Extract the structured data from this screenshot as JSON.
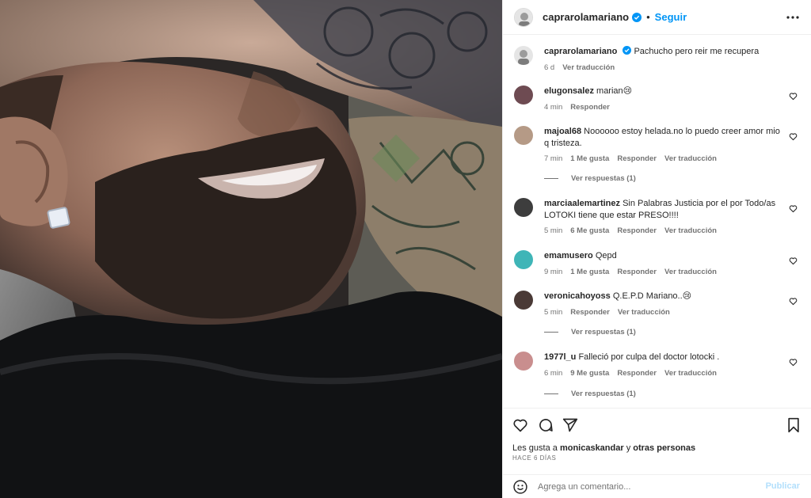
{
  "post": {
    "author": "caprarolamariano",
    "follow_label": "Seguir",
    "caption_author": "caprarolamariano",
    "caption": "Pachucho pero reir me recupera",
    "caption_time": "6 d",
    "caption_translate": "Ver traducción"
  },
  "comments": [
    {
      "user": "elugonsalez",
      "text": "marian😢",
      "time": "4 min",
      "likes": "",
      "reply": "Responder",
      "translate": "",
      "replies": ""
    },
    {
      "user": "majoal68",
      "text": "Noooooo estoy helada.no lo puedo creer amor mio q tristeza.",
      "time": "7 min",
      "likes": "1 Me gusta",
      "reply": "Responder",
      "translate": "Ver traducción",
      "replies": "Ver respuestas (1)"
    },
    {
      "user": "marciaalemartinez",
      "text": "Sin Palabras Justicia por el por Todo/as LOTOKI tiene que estar PRESO!!!!",
      "time": "5 min",
      "likes": "6 Me gusta",
      "reply": "Responder",
      "translate": "Ver traducción",
      "replies": ""
    },
    {
      "user": "emamusero",
      "text": "Qepd",
      "time": "9 min",
      "likes": "1 Me gusta",
      "reply": "Responder",
      "translate": "Ver traducción",
      "replies": ""
    },
    {
      "user": "veronicahoyoss",
      "text": "Q.E.P.D Mariano..😢",
      "time": "5 min",
      "likes": "",
      "reply": "Responder",
      "translate": "Ver traducción",
      "replies": "Ver respuestas (1)"
    },
    {
      "user": "1977l_u",
      "text": "Falleció por culpa del doctor lotocki .",
      "time": "6 min",
      "likes": "9 Me gusta",
      "reply": "Responder",
      "translate": "Ver traducción",
      "replies": "Ver respuestas (1)"
    }
  ],
  "likes": {
    "prefix": "Les gusta a",
    "user": "monicaskandar",
    "joiner": "y",
    "others": "otras personas"
  },
  "date": "HACE 6 DÍAS",
  "compose": {
    "placeholder": "Agrega un comentario...",
    "publish_label": "Publicar"
  },
  "colors": {
    "accent": "#0095f6",
    "verified": "#0095f6",
    "publish_disabled": "#b2dffc",
    "secondary_text": "#737373"
  },
  "icons": {
    "more": "more-horizontal-icon",
    "heart": "heart-icon",
    "comment": "comment-icon",
    "share": "share-icon",
    "save": "bookmark-icon",
    "emoji": "emoji-icon",
    "verified": "verified-badge-icon"
  }
}
